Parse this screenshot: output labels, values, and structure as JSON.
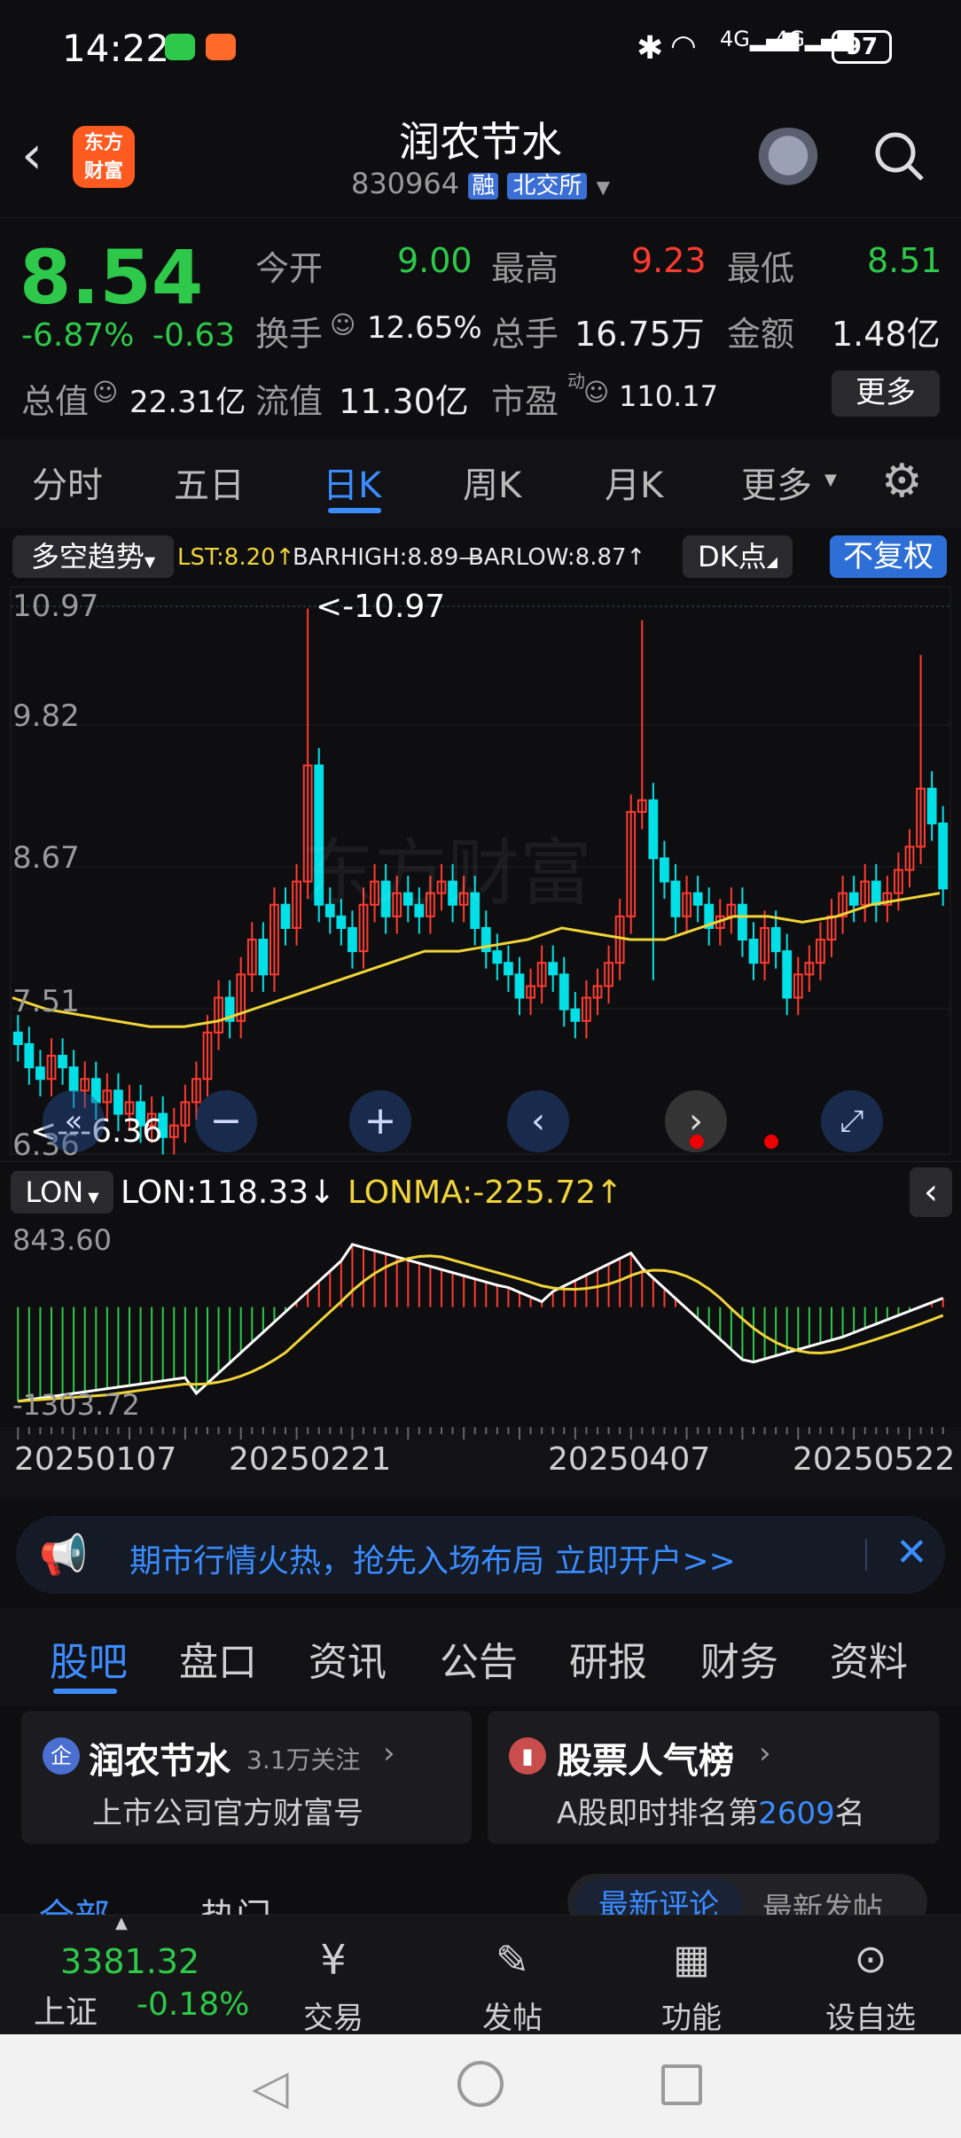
{
  "status_bar": {
    "time": "14:22",
    "network": "4G",
    "battery": "97"
  },
  "header": {
    "title": "润农节水",
    "code": "830964",
    "badge_margin": "融",
    "badge_exchange": "北交所",
    "logo_line1": "东方",
    "logo_line2": "财富"
  },
  "quote": {
    "price": "8.54",
    "change_pct": "-6.87%",
    "change": "-0.63",
    "open_label": "今开",
    "open": "9.00",
    "high_label": "最高",
    "high": "9.23",
    "low_label": "最低",
    "low": "8.51",
    "turnover_label": "换手",
    "turnover": "12.65%",
    "volume_label": "总手",
    "volume": "16.75万",
    "amount_label": "金额",
    "amount": "1.48亿",
    "mktcap_label": "总值",
    "mktcap": "22.31亿",
    "float_label": "流值",
    "float": "11.30亿",
    "pe_label": "市盈",
    "pe_sup": "动",
    "pe": "110.17",
    "more_label": "更多"
  },
  "tabs": [
    {
      "label": "分时"
    },
    {
      "label": "五日"
    },
    {
      "label": "日K"
    },
    {
      "label": "周K"
    },
    {
      "label": "月K"
    },
    {
      "label": "更多"
    }
  ],
  "chart_top": {
    "indicator": "多空趋势",
    "lst": "LST:8.20↑",
    "barhigh": "BARHIGH:8.89—",
    "barlow": "BARLOW:8.87↑",
    "dk_label": "DK点",
    "fq_label": "不复权"
  },
  "kchart": {
    "axis": [
      "10.97",
      "9.82",
      "8.67",
      "7.51",
      "6.36"
    ],
    "max_annotation": "<-10.97",
    "min_annotation": "<---6.36",
    "watermark": "东方财富"
  },
  "lon": {
    "name": "LON",
    "lon_value": "LON:118.33↓",
    "lonma_value": "LONMA:-225.72↑",
    "axis_top": "843.60",
    "axis_bottom": "-1303.72"
  },
  "dates": [
    "20250107",
    "20250221",
    "20250407",
    "20250522"
  ],
  "banner": {
    "text": "期市行情火热，抢先入场布局 立即开户>>"
  },
  "subtabs": [
    {
      "label": "股吧"
    },
    {
      "label": "盘口"
    },
    {
      "label": "资讯"
    },
    {
      "label": "公告"
    },
    {
      "label": "研报"
    },
    {
      "label": "财务"
    },
    {
      "label": "资料"
    }
  ],
  "cards": {
    "left_title": "润农节水",
    "left_follow": "3.1万关注",
    "left_sub": "上市公司官方财富号",
    "left_icon": "企",
    "right_title": "股票人气榜",
    "right_sub_prefix": "A股即时排名第",
    "right_rank": "2609",
    "right_sub_suffix": "名"
  },
  "partial_tabs": {
    "all": "全部",
    "hot": "热门",
    "latest_comment": "最新评论",
    "latest_post": "最新发帖"
  },
  "bottom_nav": {
    "index_value": "3381.32",
    "index_name": "上证",
    "index_change": "-0.18%",
    "trade": "交易",
    "post": "发帖",
    "features": "功能",
    "watchlist": "设自选"
  },
  "chart_data": {
    "type": "candlestick",
    "ylim": [
      6.36,
      10.97
    ],
    "x_ticks": [
      "20250107",
      "20250221",
      "20250407",
      "20250522"
    ],
    "ma_line": "yellow trend line",
    "lon": {
      "LON": 118.33,
      "LONMA": -225.72,
      "ylim": [
        -1303.72,
        843.6
      ]
    }
  },
  "colors": {
    "up": "#ff3b30",
    "down": "#00e0e6",
    "green": "#2ec94a",
    "accent": "#3b8cff",
    "yellow": "#f0d43a"
  }
}
